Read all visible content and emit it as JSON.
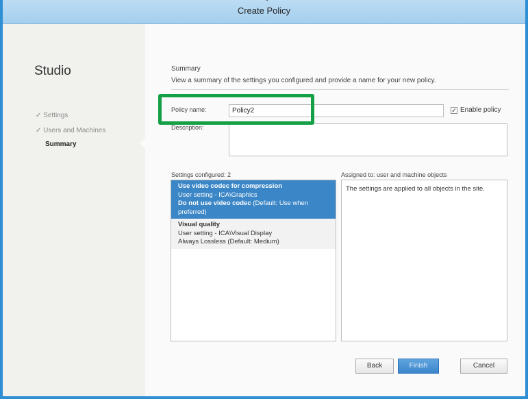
{
  "window": {
    "title": "Create Policy",
    "title_mark": "\""
  },
  "sidebar": {
    "app_name": "Studio",
    "steps": [
      {
        "label": "Settings",
        "check": "✓"
      },
      {
        "label": "Users and Machines",
        "check": "✓"
      },
      {
        "label": "Summary",
        "check": ""
      }
    ]
  },
  "summary": {
    "heading": "Summary",
    "description": "View a summary of the settings you configured and provide a name for your new policy."
  },
  "form": {
    "policy_name_label": "Policy name:",
    "policy_name_value": "Policy2",
    "enable_policy_label": "Enable policy",
    "enable_policy_checked": true,
    "description_label": "Description:",
    "description_value": ""
  },
  "settings_list": {
    "header": "Settings configured: 2",
    "groups": [
      {
        "title": "Use video codec for compression",
        "category": "User setting - ICA\\Graphics",
        "value_bold": "Do not use video codec",
        "value_rest": " (Default: Use when preferred)",
        "selected": true
      },
      {
        "title": "Visual quality",
        "category": "User setting - ICA\\Visual Display",
        "value_bold": "Always Lossless",
        "value_rest": " (Default: Medium)",
        "selected": false
      }
    ]
  },
  "assigned": {
    "header": "Assigned to:  user and machine objects",
    "text": "The settings are applied to all objects in the site."
  },
  "buttons": {
    "back": "Back",
    "finish": "Finish",
    "cancel": "Cancel"
  },
  "colors": {
    "accent": "#3b86c6",
    "highlight": "#15a047",
    "window_border": "#2f8fd4"
  },
  "icons": {
    "checkmark": "checkmark-icon"
  }
}
